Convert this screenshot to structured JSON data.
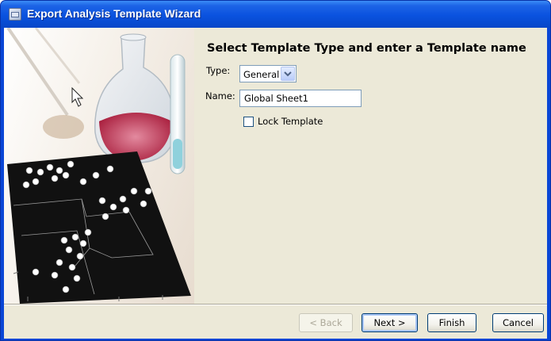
{
  "window": {
    "title": "Export Analysis Template Wizard"
  },
  "main": {
    "heading": "Select Template Type and enter a Template name",
    "type": {
      "label": "Type:",
      "value": "General"
    },
    "name": {
      "label": "Name:",
      "value": "Global Sheet1"
    },
    "lock": {
      "label": "Lock Template",
      "checked": false
    }
  },
  "buttons": {
    "back": "< Back",
    "next": "Next >",
    "finish": "Finish",
    "cancel": "Cancel"
  },
  "colors": {
    "titlebar": "#0a52df",
    "client_bg": "#ece9d8",
    "button_border": "#003c74"
  }
}
